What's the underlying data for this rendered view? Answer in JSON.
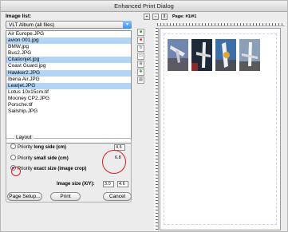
{
  "window": {
    "title": "Enhanced Print Dialog"
  },
  "image_list": {
    "label": "Image list:",
    "album": "VLT Album (all files)",
    "files": [
      {
        "name": "Air Europe.JPG",
        "selected": false
      },
      {
        "name": "avion 001.jpg",
        "selected": true
      },
      {
        "name": "BMW.jpg",
        "selected": false
      },
      {
        "name": "Bus2.JPG",
        "selected": false
      },
      {
        "name": "Citationjet.jpg",
        "selected": true
      },
      {
        "name": "Coast Guard.jpg",
        "selected": false
      },
      {
        "name": "Hawker2.JPG",
        "selected": true
      },
      {
        "name": "Iberia Air.JPG",
        "selected": false
      },
      {
        "name": "Learjet.JPG",
        "selected": true
      },
      {
        "name": "Lotus 10x15cm.tif",
        "selected": false
      },
      {
        "name": "Mooney CP2.JPG",
        "selected": false
      },
      {
        "name": "Porsche.tif",
        "selected": false
      },
      {
        "name": "Sailship.JPG",
        "selected": false
      }
    ]
  },
  "layout": {
    "legend": "Layout",
    "options": [
      {
        "prefix": "Priority",
        "label": "long side (cm)",
        "value": "4.6",
        "checked": false
      },
      {
        "prefix": "Priority",
        "label": "small side (cm)",
        "value": "6.8",
        "checked": false
      },
      {
        "prefix": "Priority",
        "label": "exact size (image crop)",
        "value": "",
        "checked": true
      }
    ],
    "image_size_label": "Image size (X/Y):",
    "image_size_x": "3.0",
    "image_size_y": "4.6"
  },
  "buttons": {
    "page_setup": "Page Setup...",
    "print": "Print",
    "cancel": "Cancel"
  },
  "preview": {
    "page_label": "Page: #1/#1",
    "thumbnail_count": 4,
    "colors": {
      "highlight": "#b3d5f5",
      "annotation": "#d81e1e"
    }
  }
}
